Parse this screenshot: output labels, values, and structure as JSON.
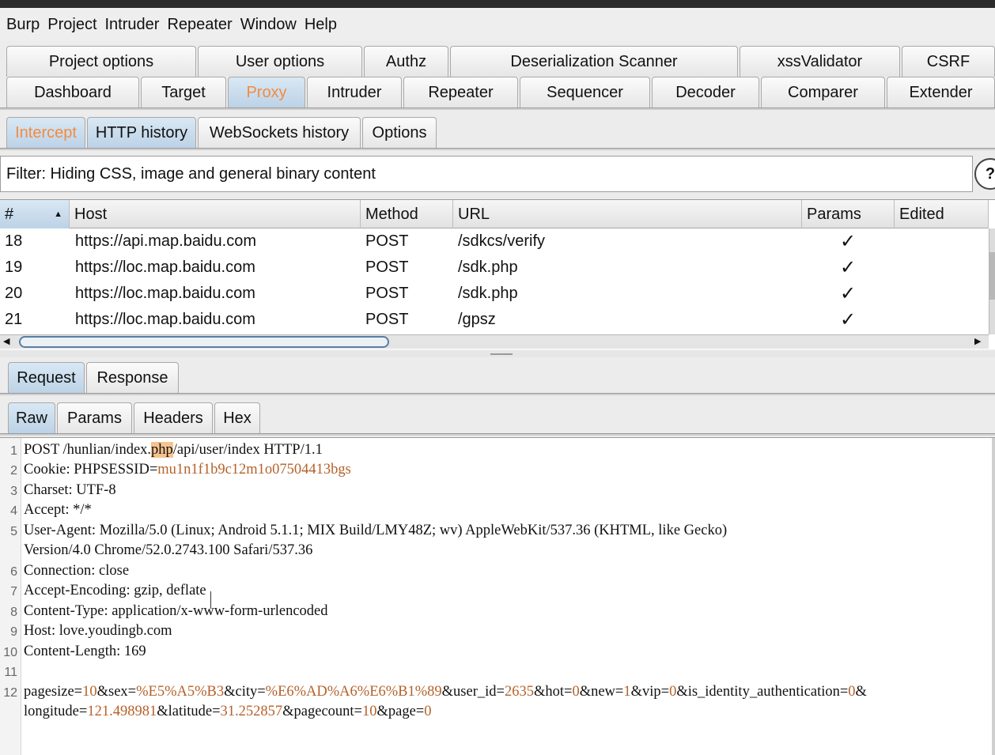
{
  "menu": [
    "Burp",
    "Project",
    "Intruder",
    "Repeater",
    "Window",
    "Help"
  ],
  "top_tabs_row1": [
    "Project options",
    "User options",
    "Authz",
    "Deserialization Scanner",
    "xssValidator",
    "CSRF"
  ],
  "top_tabs_row2": [
    "Dashboard",
    "Target",
    "Proxy",
    "Intruder",
    "Repeater",
    "Sequencer",
    "Decoder",
    "Comparer",
    "Extender"
  ],
  "proxy_tabs": [
    "Intercept",
    "HTTP history",
    "WebSockets history",
    "Options"
  ],
  "filter": {
    "text": "Filter: Hiding CSS, image and general binary content",
    "help": "?"
  },
  "table": {
    "columns": [
      "#",
      "Host",
      "Method",
      "URL",
      "Params",
      "Edited"
    ],
    "sort_arrow": "▲",
    "rows": [
      {
        "num": "18",
        "host": "https://api.map.baidu.com",
        "method": "POST",
        "url": "/sdkcs/verify",
        "params": "✓",
        "edited": ""
      },
      {
        "num": "19",
        "host": "https://loc.map.baidu.com",
        "method": "POST",
        "url": "/sdk.php",
        "params": "✓",
        "edited": ""
      },
      {
        "num": "20",
        "host": "https://loc.map.baidu.com",
        "method": "POST",
        "url": "/sdk.php",
        "params": "✓",
        "edited": ""
      },
      {
        "num": "21",
        "host": "https://loc.map.baidu.com",
        "method": "POST",
        "url": "/gpsz",
        "params": "✓",
        "edited": ""
      }
    ]
  },
  "message_tabs": [
    "Request",
    "Response"
  ],
  "view_tabs": [
    "Raw",
    "Params",
    "Headers",
    "Hex"
  ],
  "request": {
    "line_numbers": [
      "1",
      "2",
      "3",
      "4",
      "5",
      "",
      "6",
      "7",
      "8",
      "9",
      "10",
      "11",
      "12",
      ""
    ],
    "l1_a": "POST /hunlian/index.",
    "l1_hl": "php",
    "l1_b": "/api/user/index HTTP/1.1",
    "l2_k": "Cookie: PHPSESSID=",
    "l2_v": "mu1n1f1b9c12m1o07504413bgs",
    "l3": "Charset: UTF-8",
    "l4": "Accept: */*",
    "l5": "User-Agent: Mozilla/5.0 (Linux; Android 5.1.1; MIX Build/LMY48Z; wv) AppleWebKit/537.36 (KHTML, like Gecko)",
    "l5b": "Version/4.0 Chrome/52.0.2743.100 Safari/537.36",
    "l6": "Connection: close",
    "l7": "Accept-Encoding: gzip, deflate",
    "l8": "Content-Type: application/x-www-form-urlencoded",
    "l9": "Host: love.youdingb.com",
    "l10": "Content-Length: 169",
    "l12_p1": "pagesize=",
    "l12_v1": "10",
    "l12_p2": "&sex=",
    "l12_v2": "%E5%A5%B3",
    "l12_p3": "&city=",
    "l12_v3": "%E6%AD%A6%E6%B1%89",
    "l12_p4": "&user_id=",
    "l12_v4": "2635",
    "l12_p5": "&hot=",
    "l12_v5": "0",
    "l12_p6": "&new=",
    "l12_v6": "1",
    "l12_p7": "&vip=",
    "l12_v7": "0",
    "l12_p8": "&is_identity_authentication=",
    "l12_v8": "0",
    "l12_p9": "&",
    "l13_p1": "longitude=",
    "l13_v1": "121.498981",
    "l13_p2": "&latitude=",
    "l13_v2": "31.252857",
    "l13_p3": "&pagecount=",
    "l13_v3": "10",
    "l13_p4": "&page=",
    "l13_v4": "0"
  }
}
